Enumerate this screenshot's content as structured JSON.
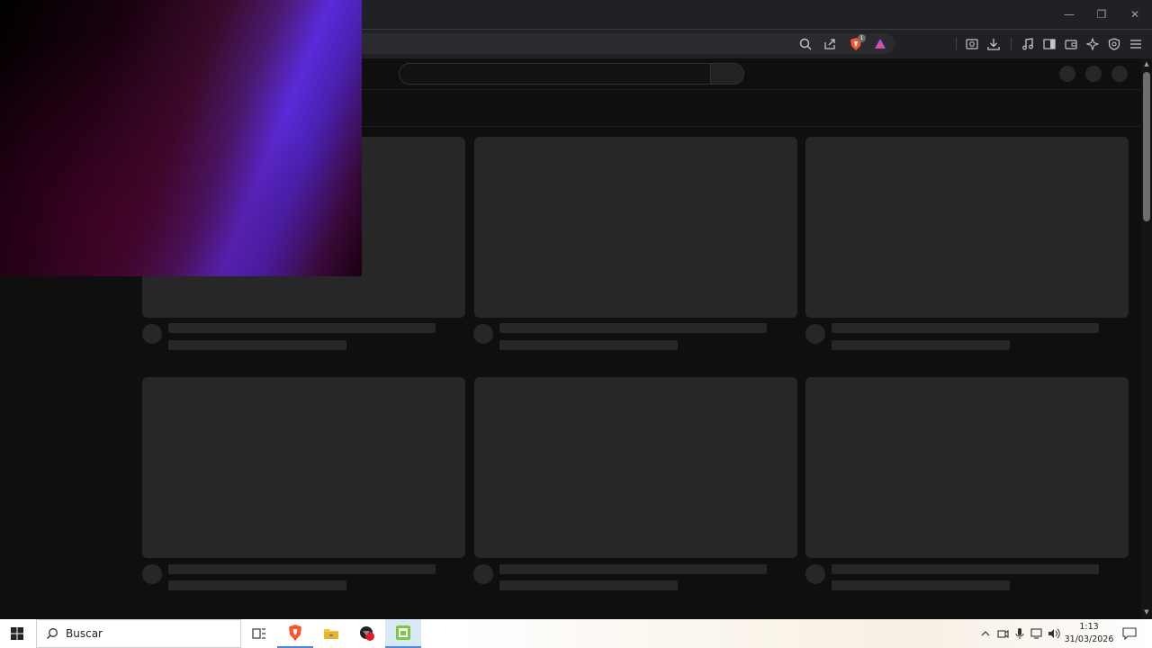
{
  "window": {
    "controls": [
      "minimize",
      "restore",
      "close"
    ]
  },
  "toolbar": {
    "icons": [
      "search-icon",
      "share-icon",
      "brave-shields-icon",
      "brave-rewards-icon"
    ],
    "brave_badge": "1",
    "right_icons": [
      "screenshot-icon",
      "download-icon",
      "media-icon",
      "sidebar-icon",
      "wallet-icon",
      "leo-ai-icon",
      "vpn-icon",
      "menu-icon"
    ]
  },
  "taskbar": {
    "search_placeholder": "Buscar",
    "apps": [
      "task-view-icon",
      "brave-icon",
      "file-explorer-icon",
      "app-red-icon",
      "app-green-icon"
    ],
    "clock": {
      "time": "1:13",
      "date": "31/03/2026"
    }
  },
  "colors": {
    "page_bg": "#0f0f0f",
    "skeleton": "#272727",
    "chrome_bg": "#202124",
    "taskbar_bg": "#ffffff"
  }
}
